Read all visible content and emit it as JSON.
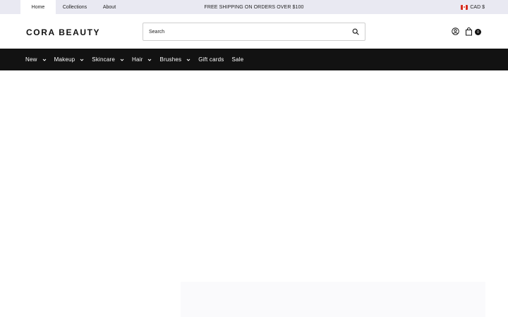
{
  "topbar": {
    "tabs": [
      {
        "label": "Home"
      },
      {
        "label": "Collections"
      },
      {
        "label": "About"
      }
    ],
    "promo": "FREE SHIPPING ON ORDERS OVER $100",
    "currency": "CAD $"
  },
  "header": {
    "logo": "CORA BEAUTY",
    "search_placeholder": "Search",
    "cart_count": "0"
  },
  "nav": {
    "items": [
      {
        "label": "New",
        "has_dropdown": true
      },
      {
        "label": "Makeup",
        "has_dropdown": true
      },
      {
        "label": "Skincare",
        "has_dropdown": true
      },
      {
        "label": "Hair",
        "has_dropdown": true
      },
      {
        "label": "Brushes",
        "has_dropdown": true
      },
      {
        "label": "Gift cards",
        "has_dropdown": false
      },
      {
        "label": "Sale",
        "has_dropdown": false
      }
    ]
  },
  "colors": {
    "topbar_bg": "#e9e9f2",
    "nav_bg": "#121212",
    "text": "#111111"
  }
}
